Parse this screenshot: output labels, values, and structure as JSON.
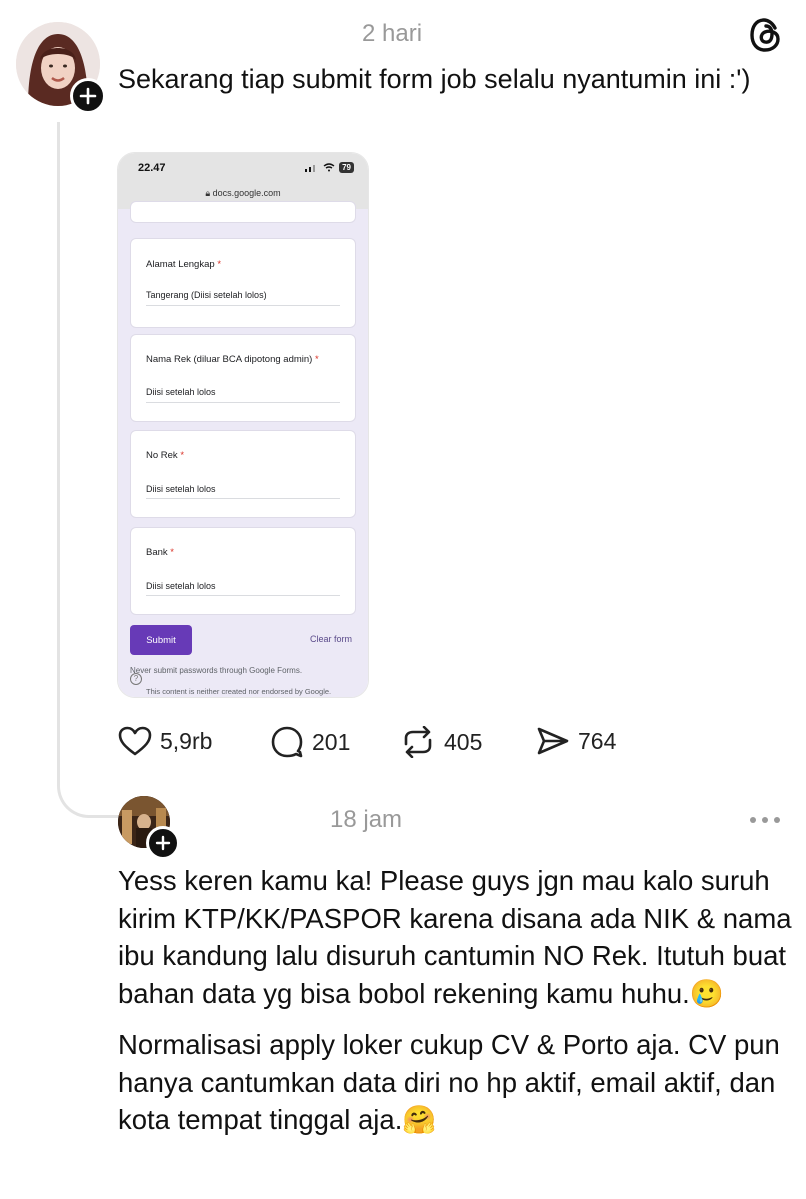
{
  "post": {
    "time": "2 hari",
    "text": "Sekarang tiap submit form job selalu nyantumin ini :')",
    "screenshot": {
      "status_time": "22.47",
      "battery": "79",
      "url": "docs.google.com",
      "fields": [
        {
          "label": "Alamat Lengkap",
          "required": "*",
          "value": "Tangerang (Diisi setelah lolos)"
        },
        {
          "label": "Nama Rek (diluar BCA dipotong admin)",
          "required": "*",
          "value": "Diisi setelah lolos"
        },
        {
          "label": "No Rek",
          "required": "*",
          "value": "Diisi setelah lolos"
        },
        {
          "label": "Bank",
          "required": "*",
          "value": "Diisi setelah lolos"
        }
      ],
      "submit_label": "Submit",
      "clear_label": "Clear form",
      "note_passwords": "Never submit passwords through Google Forms.",
      "note_endorse": "This content is neither created nor endorsed by Google."
    },
    "stats": {
      "likes": "5,9rb",
      "replies": "201",
      "reposts": "405",
      "shares": "764"
    }
  },
  "reply": {
    "time": "18 jam",
    "paragraph1": "Yess keren kamu ka! Please guys jgn mau kalo suruh kirim KTP/KK/PASPOR karena disana ada NIK & nama ibu kandung lalu disuruh cantumin NO Rek. Itutuh buat bahan data yg bisa bobol rekening kamu huhu.",
    "emoji1": "🥲",
    "paragraph2": "Normalisasi apply loker cukup CV & Porto aja. CV pun hanya cantumkan data diri no hp aktif, email aktif, dan kota tempat tinggal aja.",
    "emoji2": "🤗"
  },
  "icons": {
    "threads_logo": "threads-logo-icon",
    "more": "more-horizontal-icon",
    "heart": "heart-icon",
    "comment": "comment-icon",
    "repost": "repost-icon",
    "share": "send-icon",
    "add_follow": "plus-icon"
  }
}
